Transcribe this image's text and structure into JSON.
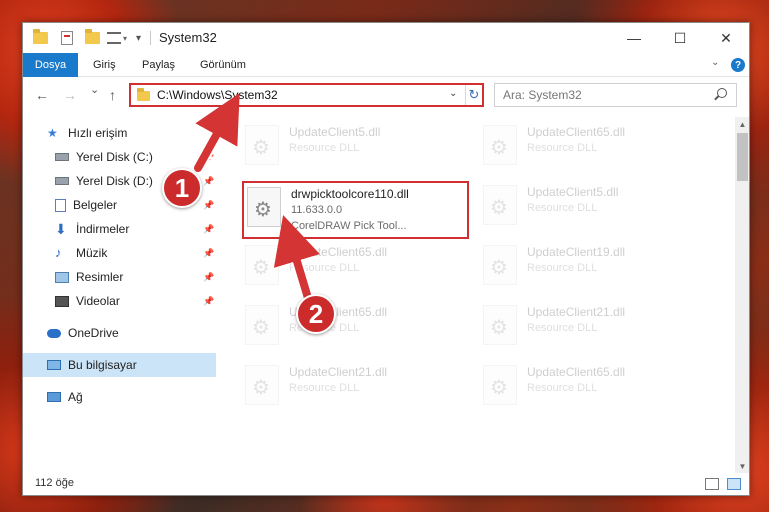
{
  "window": {
    "title": "System32",
    "minimize": "—",
    "maximize": "☐",
    "close": "✕"
  },
  "ribbon": {
    "tabs": [
      "Dosya",
      "Giriş",
      "Paylaş",
      "Görünüm"
    ]
  },
  "navigation": {
    "back": "←",
    "forward": "→",
    "recent": "⌄",
    "up": "↑",
    "address": "C:\\Windows\\System32",
    "search_placeholder": "Ara: System32"
  },
  "sidebar": {
    "items": [
      {
        "label": "Hızlı erişim",
        "icon": "star-icon"
      },
      {
        "label": "Yerel Disk (C:)",
        "icon": "drive-icon"
      },
      {
        "label": "Yerel Disk (D:)",
        "icon": "drive-icon"
      },
      {
        "label": "Belgeler",
        "icon": "documents-icon"
      },
      {
        "label": "İndirmeler",
        "icon": "download-icon"
      },
      {
        "label": "Müzik",
        "icon": "music-icon"
      },
      {
        "label": "Resimler",
        "icon": "pictures-icon"
      },
      {
        "label": "Videolar",
        "icon": "video-icon"
      },
      {
        "label": "OneDrive",
        "icon": "cloud-icon"
      },
      {
        "label": "Bu bilgisayar",
        "icon": "computer-icon"
      },
      {
        "label": "Ağ",
        "icon": "network-icon"
      }
    ]
  },
  "files": {
    "highlighted": {
      "name": "drwpicktoolcore110.dll",
      "version": "11.633.0.0",
      "description": "CorelDRAW Pick Tool..."
    },
    "faded": [
      {
        "name": "UpdateClient5.dll",
        "description": "Resource DLL"
      },
      {
        "name": "UpdateClient65.dll",
        "description": "Resource DLL"
      },
      {
        "name": "UpdateClient5.dll",
        "description": "Resource DLL"
      },
      {
        "name": "UpdateClient65.dll",
        "description": "Resource DLL"
      },
      {
        "name": "UpdateClient19.dll",
        "description": "Resource DLL"
      },
      {
        "name": "UpdateClient65.dll",
        "description": "Resource DLL"
      },
      {
        "name": "UpdateClient21.dll",
        "description": "Resource DLL"
      },
      {
        "name": "UpdateClient21.dll",
        "description": "Resource DLL"
      },
      {
        "name": "UpdateClient65.dll",
        "description": "Resource DLL"
      }
    ]
  },
  "status": {
    "count": "112 öğe"
  },
  "callouts": [
    "1",
    "2"
  ],
  "colors": {
    "accent": "#1979ca",
    "highlight_border": "#d03030",
    "callout": "#cc2b2b",
    "selected": "#cce4f7"
  }
}
